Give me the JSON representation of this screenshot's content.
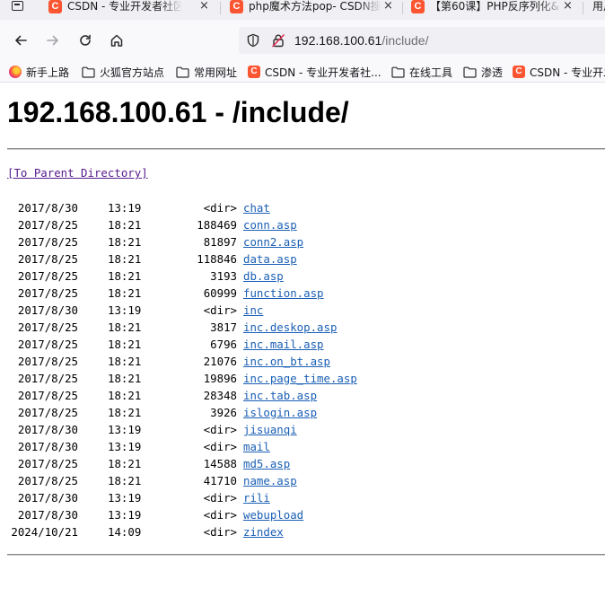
{
  "browser": {
    "tabs": [
      {
        "title": "CSDN - 专业开发者社区",
        "favicon": "C",
        "close": "×"
      },
      {
        "title": "php魔术方法pop- CSDN搜索",
        "favicon": "C",
        "close": "×"
      },
      {
        "title": "【第60课】PHP反序列化&",
        "favicon": "C",
        "close": "×"
      },
      {
        "title": "用户",
        "favicon": "",
        "close": ""
      }
    ],
    "url": {
      "host": "192.168.100.61",
      "path": "/include/"
    },
    "bookmarks": [
      {
        "label": "新手上路",
        "icon": "firefox-icon"
      },
      {
        "label": "火狐官方站点",
        "icon": "folder-icon"
      },
      {
        "label": "常用网址",
        "icon": "folder-icon"
      },
      {
        "label": "CSDN - 专业开发者社...",
        "icon": "csdn-icon"
      },
      {
        "label": "在线工具",
        "icon": "folder-icon"
      },
      {
        "label": "渗透",
        "icon": "folder-icon"
      },
      {
        "label": "CSDN - 专业开发",
        "icon": "csdn-icon"
      }
    ],
    "accent_color": "#fc5531"
  },
  "page": {
    "title": "192.168.100.61 - /include/",
    "parent_link": "[To Parent Directory]",
    "entries": [
      {
        "date": "2017/8/30",
        "time": "13:19",
        "size": "<dir>",
        "name": "chat"
      },
      {
        "date": "2017/8/25",
        "time": "18:21",
        "size": "188469",
        "name": "conn.asp"
      },
      {
        "date": "2017/8/25",
        "time": "18:21",
        "size": "81897",
        "name": "conn2.asp"
      },
      {
        "date": "2017/8/25",
        "time": "18:21",
        "size": "118846",
        "name": "data.asp"
      },
      {
        "date": "2017/8/25",
        "time": "18:21",
        "size": "3193",
        "name": "db.asp"
      },
      {
        "date": "2017/8/25",
        "time": "18:21",
        "size": "60999",
        "name": "function.asp"
      },
      {
        "date": "2017/8/30",
        "time": "13:19",
        "size": "<dir>",
        "name": "inc"
      },
      {
        "date": "2017/8/25",
        "time": "18:21",
        "size": "3817",
        "name": "inc.deskop.asp"
      },
      {
        "date": "2017/8/25",
        "time": "18:21",
        "size": "6796",
        "name": "inc.mail.asp"
      },
      {
        "date": "2017/8/25",
        "time": "18:21",
        "size": "21076",
        "name": "inc.on_bt.asp"
      },
      {
        "date": "2017/8/25",
        "time": "18:21",
        "size": "19896",
        "name": "inc.page_time.asp"
      },
      {
        "date": "2017/8/25",
        "time": "18:21",
        "size": "28348",
        "name": "inc.tab.asp"
      },
      {
        "date": "2017/8/25",
        "time": "18:21",
        "size": "3926",
        "name": "islogin.asp"
      },
      {
        "date": "2017/8/30",
        "time": "13:19",
        "size": "<dir>",
        "name": "jisuanqi"
      },
      {
        "date": "2017/8/30",
        "time": "13:19",
        "size": "<dir>",
        "name": "mail"
      },
      {
        "date": "2017/8/25",
        "time": "18:21",
        "size": "14588",
        "name": "md5.asp"
      },
      {
        "date": "2017/8/25",
        "time": "18:21",
        "size": "41710",
        "name": "name.asp"
      },
      {
        "date": "2017/8/30",
        "time": "13:19",
        "size": "<dir>",
        "name": "rili"
      },
      {
        "date": "2017/8/30",
        "time": "13:19",
        "size": "<dir>",
        "name": "webupload"
      },
      {
        "date": "2024/10/21",
        "time": "14:09",
        "size": "<dir>",
        "name": "zindex"
      }
    ]
  }
}
